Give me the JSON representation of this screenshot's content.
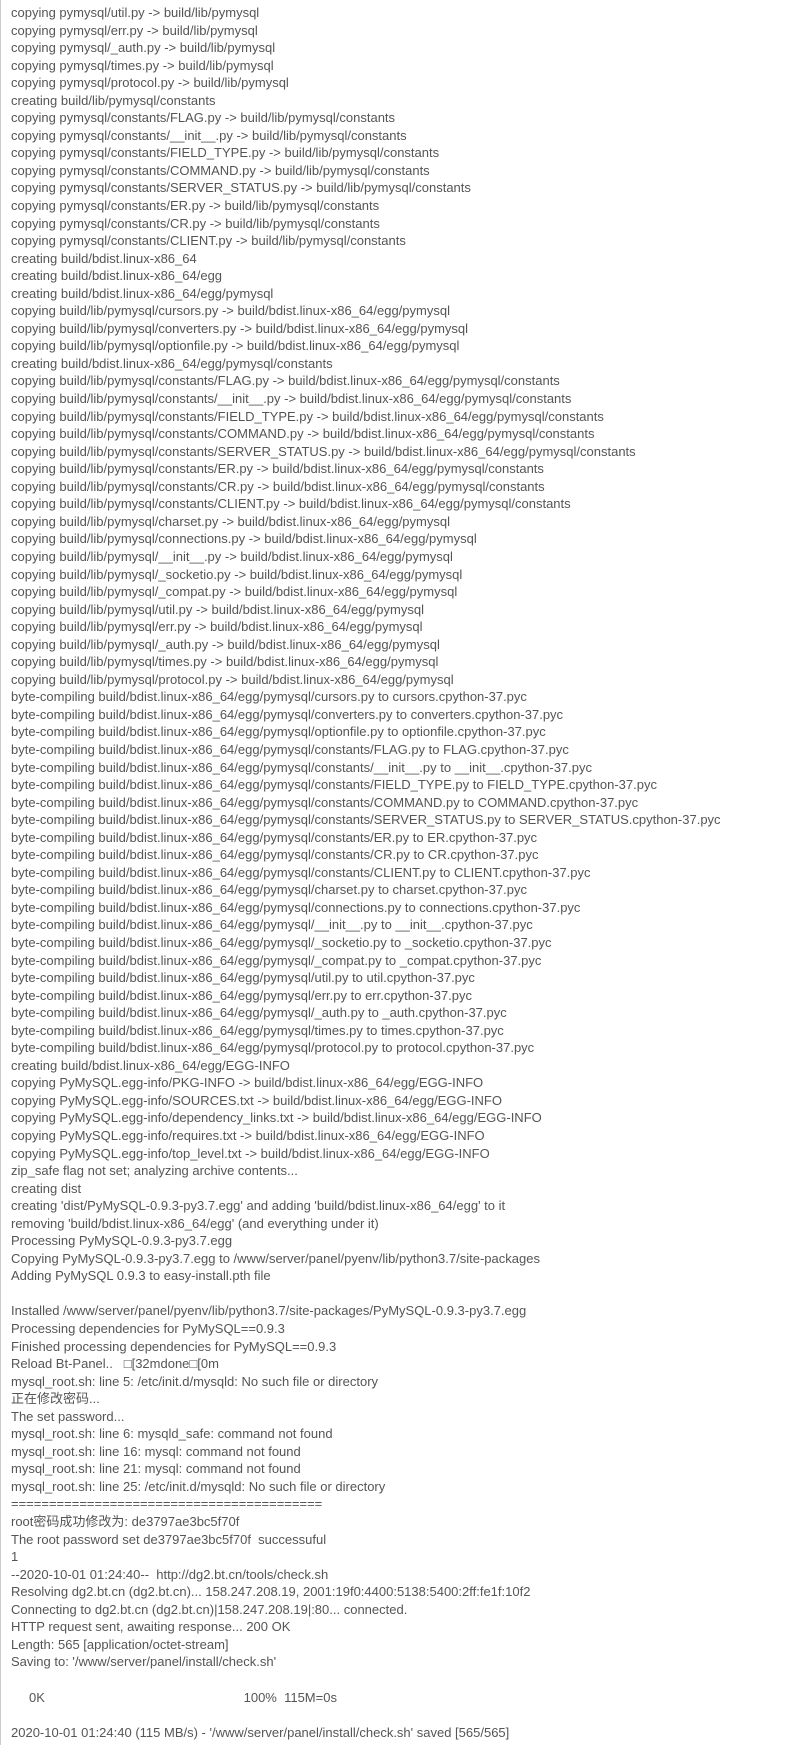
{
  "lines": [
    "copying pymysql/util.py -> build/lib/pymysql",
    "copying pymysql/err.py -> build/lib/pymysql",
    "copying pymysql/_auth.py -> build/lib/pymysql",
    "copying pymysql/times.py -> build/lib/pymysql",
    "copying pymysql/protocol.py -> build/lib/pymysql",
    "creating build/lib/pymysql/constants",
    "copying pymysql/constants/FLAG.py -> build/lib/pymysql/constants",
    "copying pymysql/constants/__init__.py -> build/lib/pymysql/constants",
    "copying pymysql/constants/FIELD_TYPE.py -> build/lib/pymysql/constants",
    "copying pymysql/constants/COMMAND.py -> build/lib/pymysql/constants",
    "copying pymysql/constants/SERVER_STATUS.py -> build/lib/pymysql/constants",
    "copying pymysql/constants/ER.py -> build/lib/pymysql/constants",
    "copying pymysql/constants/CR.py -> build/lib/pymysql/constants",
    "copying pymysql/constants/CLIENT.py -> build/lib/pymysql/constants",
    "creating build/bdist.linux-x86_64",
    "creating build/bdist.linux-x86_64/egg",
    "creating build/bdist.linux-x86_64/egg/pymysql",
    "copying build/lib/pymysql/cursors.py -> build/bdist.linux-x86_64/egg/pymysql",
    "copying build/lib/pymysql/converters.py -> build/bdist.linux-x86_64/egg/pymysql",
    "copying build/lib/pymysql/optionfile.py -> build/bdist.linux-x86_64/egg/pymysql",
    "creating build/bdist.linux-x86_64/egg/pymysql/constants",
    "copying build/lib/pymysql/constants/FLAG.py -> build/bdist.linux-x86_64/egg/pymysql/constants",
    "copying build/lib/pymysql/constants/__init__.py -> build/bdist.linux-x86_64/egg/pymysql/constants",
    "copying build/lib/pymysql/constants/FIELD_TYPE.py -> build/bdist.linux-x86_64/egg/pymysql/constants",
    "copying build/lib/pymysql/constants/COMMAND.py -> build/bdist.linux-x86_64/egg/pymysql/constants",
    "copying build/lib/pymysql/constants/SERVER_STATUS.py -> build/bdist.linux-x86_64/egg/pymysql/constants",
    "copying build/lib/pymysql/constants/ER.py -> build/bdist.linux-x86_64/egg/pymysql/constants",
    "copying build/lib/pymysql/constants/CR.py -> build/bdist.linux-x86_64/egg/pymysql/constants",
    "copying build/lib/pymysql/constants/CLIENT.py -> build/bdist.linux-x86_64/egg/pymysql/constants",
    "copying build/lib/pymysql/charset.py -> build/bdist.linux-x86_64/egg/pymysql",
    "copying build/lib/pymysql/connections.py -> build/bdist.linux-x86_64/egg/pymysql",
    "copying build/lib/pymysql/__init__.py -> build/bdist.linux-x86_64/egg/pymysql",
    "copying build/lib/pymysql/_socketio.py -> build/bdist.linux-x86_64/egg/pymysql",
    "copying build/lib/pymysql/_compat.py -> build/bdist.linux-x86_64/egg/pymysql",
    "copying build/lib/pymysql/util.py -> build/bdist.linux-x86_64/egg/pymysql",
    "copying build/lib/pymysql/err.py -> build/bdist.linux-x86_64/egg/pymysql",
    "copying build/lib/pymysql/_auth.py -> build/bdist.linux-x86_64/egg/pymysql",
    "copying build/lib/pymysql/times.py -> build/bdist.linux-x86_64/egg/pymysql",
    "copying build/lib/pymysql/protocol.py -> build/bdist.linux-x86_64/egg/pymysql",
    "byte-compiling build/bdist.linux-x86_64/egg/pymysql/cursors.py to cursors.cpython-37.pyc",
    "byte-compiling build/bdist.linux-x86_64/egg/pymysql/converters.py to converters.cpython-37.pyc",
    "byte-compiling build/bdist.linux-x86_64/egg/pymysql/optionfile.py to optionfile.cpython-37.pyc",
    "byte-compiling build/bdist.linux-x86_64/egg/pymysql/constants/FLAG.py to FLAG.cpython-37.pyc",
    "byte-compiling build/bdist.linux-x86_64/egg/pymysql/constants/__init__.py to __init__.cpython-37.pyc",
    "byte-compiling build/bdist.linux-x86_64/egg/pymysql/constants/FIELD_TYPE.py to FIELD_TYPE.cpython-37.pyc",
    "byte-compiling build/bdist.linux-x86_64/egg/pymysql/constants/COMMAND.py to COMMAND.cpython-37.pyc",
    "byte-compiling build/bdist.linux-x86_64/egg/pymysql/constants/SERVER_STATUS.py to SERVER_STATUS.cpython-37.pyc",
    "byte-compiling build/bdist.linux-x86_64/egg/pymysql/constants/ER.py to ER.cpython-37.pyc",
    "byte-compiling build/bdist.linux-x86_64/egg/pymysql/constants/CR.py to CR.cpython-37.pyc",
    "byte-compiling build/bdist.linux-x86_64/egg/pymysql/constants/CLIENT.py to CLIENT.cpython-37.pyc",
    "byte-compiling build/bdist.linux-x86_64/egg/pymysql/charset.py to charset.cpython-37.pyc",
    "byte-compiling build/bdist.linux-x86_64/egg/pymysql/connections.py to connections.cpython-37.pyc",
    "byte-compiling build/bdist.linux-x86_64/egg/pymysql/__init__.py to __init__.cpython-37.pyc",
    "byte-compiling build/bdist.linux-x86_64/egg/pymysql/_socketio.py to _socketio.cpython-37.pyc",
    "byte-compiling build/bdist.linux-x86_64/egg/pymysql/_compat.py to _compat.cpython-37.pyc",
    "byte-compiling build/bdist.linux-x86_64/egg/pymysql/util.py to util.cpython-37.pyc",
    "byte-compiling build/bdist.linux-x86_64/egg/pymysql/err.py to err.cpython-37.pyc",
    "byte-compiling build/bdist.linux-x86_64/egg/pymysql/_auth.py to _auth.cpython-37.pyc",
    "byte-compiling build/bdist.linux-x86_64/egg/pymysql/times.py to times.cpython-37.pyc",
    "byte-compiling build/bdist.linux-x86_64/egg/pymysql/protocol.py to protocol.cpython-37.pyc",
    "creating build/bdist.linux-x86_64/egg/EGG-INFO",
    "copying PyMySQL.egg-info/PKG-INFO -> build/bdist.linux-x86_64/egg/EGG-INFO",
    "copying PyMySQL.egg-info/SOURCES.txt -> build/bdist.linux-x86_64/egg/EGG-INFO",
    "copying PyMySQL.egg-info/dependency_links.txt -> build/bdist.linux-x86_64/egg/EGG-INFO",
    "copying PyMySQL.egg-info/requires.txt -> build/bdist.linux-x86_64/egg/EGG-INFO",
    "copying PyMySQL.egg-info/top_level.txt -> build/bdist.linux-x86_64/egg/EGG-INFO",
    "zip_safe flag not set; analyzing archive contents...",
    "creating dist",
    "creating 'dist/PyMySQL-0.9.3-py3.7.egg' and adding 'build/bdist.linux-x86_64/egg' to it",
    "removing 'build/bdist.linux-x86_64/egg' (and everything under it)",
    "Processing PyMySQL-0.9.3-py3.7.egg",
    "Copying PyMySQL-0.9.3-py3.7.egg to /www/server/panel/pyenv/lib/python3.7/site-packages",
    "Adding PyMySQL 0.9.3 to easy-install.pth file",
    "",
    "Installed /www/server/panel/pyenv/lib/python3.7/site-packages/PyMySQL-0.9.3-py3.7.egg",
    "Processing dependencies for PyMySQL==0.9.3",
    "Finished processing dependencies for PyMySQL==0.9.3",
    "Reload Bt-Panel..   \u001b[32mdone\u001b[0m",
    "mysql_root.sh: line 5: /etc/init.d/mysqld: No such file or directory",
    "正在修改密码...",
    "The set password...",
    "mysql_root.sh: line 6: mysqld_safe: command not found",
    "mysql_root.sh: line 16: mysql: command not found",
    "mysql_root.sh: line 21: mysql: command not found",
    "mysql_root.sh: line 25: /etc/init.d/mysqld: No such file or directory",
    "=========================================",
    "root密码成功修改为: de3797ae3bc5f70f",
    "The root password set de3797ae3bc5f70f  successuful",
    "1",
    "--2020-10-01 01:24:40--  http://dg2.bt.cn/tools/check.sh",
    "Resolving dg2.bt.cn (dg2.bt.cn)... 158.247.208.19, 2001:19f0:4400:5138:5400:2ff:fe1f:10f2",
    "Connecting to dg2.bt.cn (dg2.bt.cn)|158.247.208.19|:80... connected.",
    "HTTP request sent, awaiting response... 200 OK",
    "Length: 565 [application/octet-stream]",
    "Saving to: '/www/server/panel/install/check.sh'",
    "",
    "     0K                                                       100%  115M=0s",
    "",
    "2020-10-01 01:24:40 (115 MB/s) - '/www/server/panel/install/check.sh' saved [565/565]"
  ]
}
